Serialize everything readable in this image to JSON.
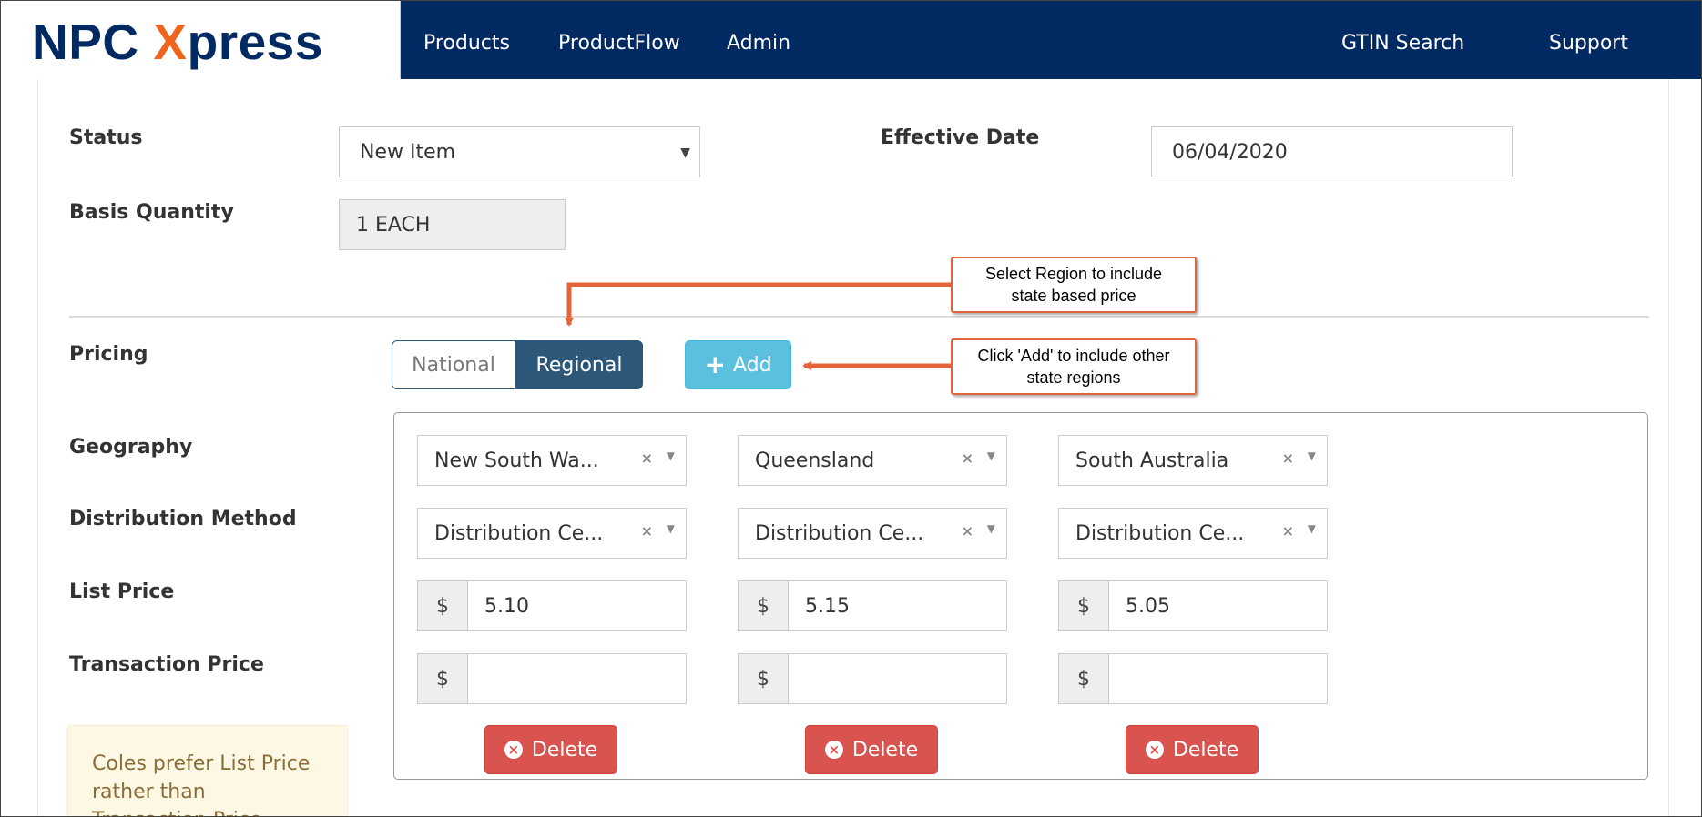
{
  "nav": {
    "brand_npc": "NPC ",
    "brand_x": "X",
    "brand_press": "press",
    "products": "Products",
    "productflow": "ProductFlow",
    "admin": "Admin",
    "gtin_search": "GTIN Search",
    "support": "Support"
  },
  "form": {
    "status_label": "Status",
    "status_value": "New Item",
    "effective_date_label": "Effective Date",
    "effective_date_value": "06/04/2020",
    "basis_quantity_label": "Basis Quantity",
    "basis_quantity_value": "1 EACH"
  },
  "pricing": {
    "label": "Pricing",
    "national": "National",
    "regional": "Regional",
    "add": "Add",
    "selected": "Regional"
  },
  "rows": {
    "geography": "Geography",
    "distribution_method": "Distribution Method",
    "list_price": "List Price",
    "transaction_price": "Transaction Price"
  },
  "regions": [
    {
      "geography": "New South Wa...",
      "distribution": "Distribution Ce...",
      "currency": "$",
      "list_price": "5.10",
      "transaction_price": "",
      "delete": "Delete"
    },
    {
      "geography": "Queensland",
      "distribution": "Distribution Ce...",
      "currency": "$",
      "list_price": "5.15",
      "transaction_price": "",
      "delete": "Delete"
    },
    {
      "geography": "South Australia",
      "distribution": "Distribution Ce...",
      "currency": "$",
      "list_price": "5.05",
      "transaction_price": "",
      "delete": "Delete"
    }
  ],
  "note": {
    "line1": "Coles prefer List Price",
    "line2": "rather than",
    "line3": "Transaction Price"
  },
  "callouts": {
    "region_line1": "Select Region to include",
    "region_line2": "state based price",
    "add_line1": "Click 'Add' to include other",
    "add_line2": "state regions"
  },
  "colors": {
    "navbar": "#012a63",
    "brand_accent": "#f0641e",
    "regional_active": "#2d5778",
    "add_button": "#5bc0de",
    "delete_button": "#d9534f",
    "callout_border": "#e4643a"
  }
}
